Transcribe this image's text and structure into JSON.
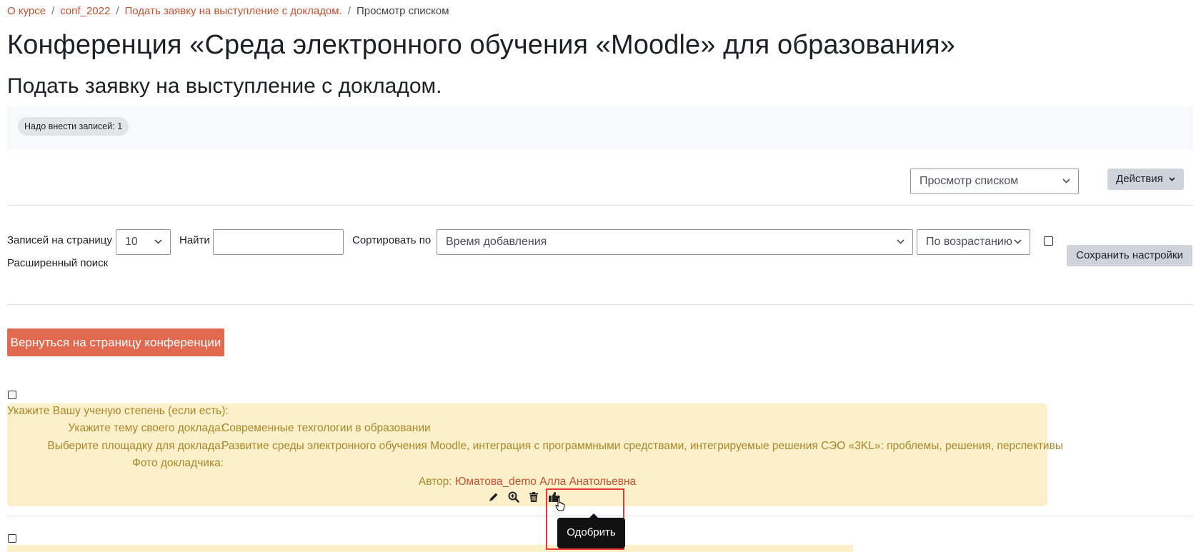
{
  "breadcrumb": {
    "items": [
      "О курсе",
      "conf_2022",
      "Подать заявку на выступление с докладом."
    ],
    "current": "Просмотр списком",
    "separator": "/"
  },
  "page": {
    "title": "Конференция «Среда электронного обучения «Moodle» для образования»",
    "subtitle": "Подать заявку на выступление с докладом."
  },
  "notice": {
    "badge": "Надо внести записей: 1"
  },
  "view": {
    "select_value": "Просмотр списком",
    "actions_label": "Действия"
  },
  "search": {
    "per_page_label": "Записей на страницу",
    "per_page_value": "10",
    "find_label": "Найти",
    "find_value": "",
    "sort_label": "Сортировать по",
    "sort_value": "Время добавления",
    "order_value": "По возрастанию",
    "advanced_label": "Расширенный поиск",
    "save_label": "Сохранить настройки"
  },
  "back_button": "Вернуться на страницу конференции",
  "entry": {
    "fields": [
      {
        "label": "Укажите Вашу ученую степень (если есть):",
        "value": ""
      },
      {
        "label": "Укажите тему своего доклада:",
        "value": "Современные техгологии в образовании"
      },
      {
        "label": "Выберите площадку для доклада:",
        "value": "Развитие среды электронного обучения Moodle, интеграция с программными средствами, интегрируемые решения СЭО «3KL»: проблемы, решения, перспективы"
      },
      {
        "label": "Фото докладчика:",
        "value": ""
      }
    ],
    "author_label": "Автор:",
    "author_name": "Юматова_demo Алла Анатольевна",
    "actions": [
      "pencil-icon",
      "zoom-icon",
      "trash-icon",
      "thumbs-up-icon"
    ]
  },
  "tooltip": "Одобрить",
  "colors": {
    "link": "#c4502f",
    "primary": "#e1694f",
    "entry_bg": "#fcf0cb",
    "entry_text": "#a8862a",
    "highlight": "#e53935"
  }
}
